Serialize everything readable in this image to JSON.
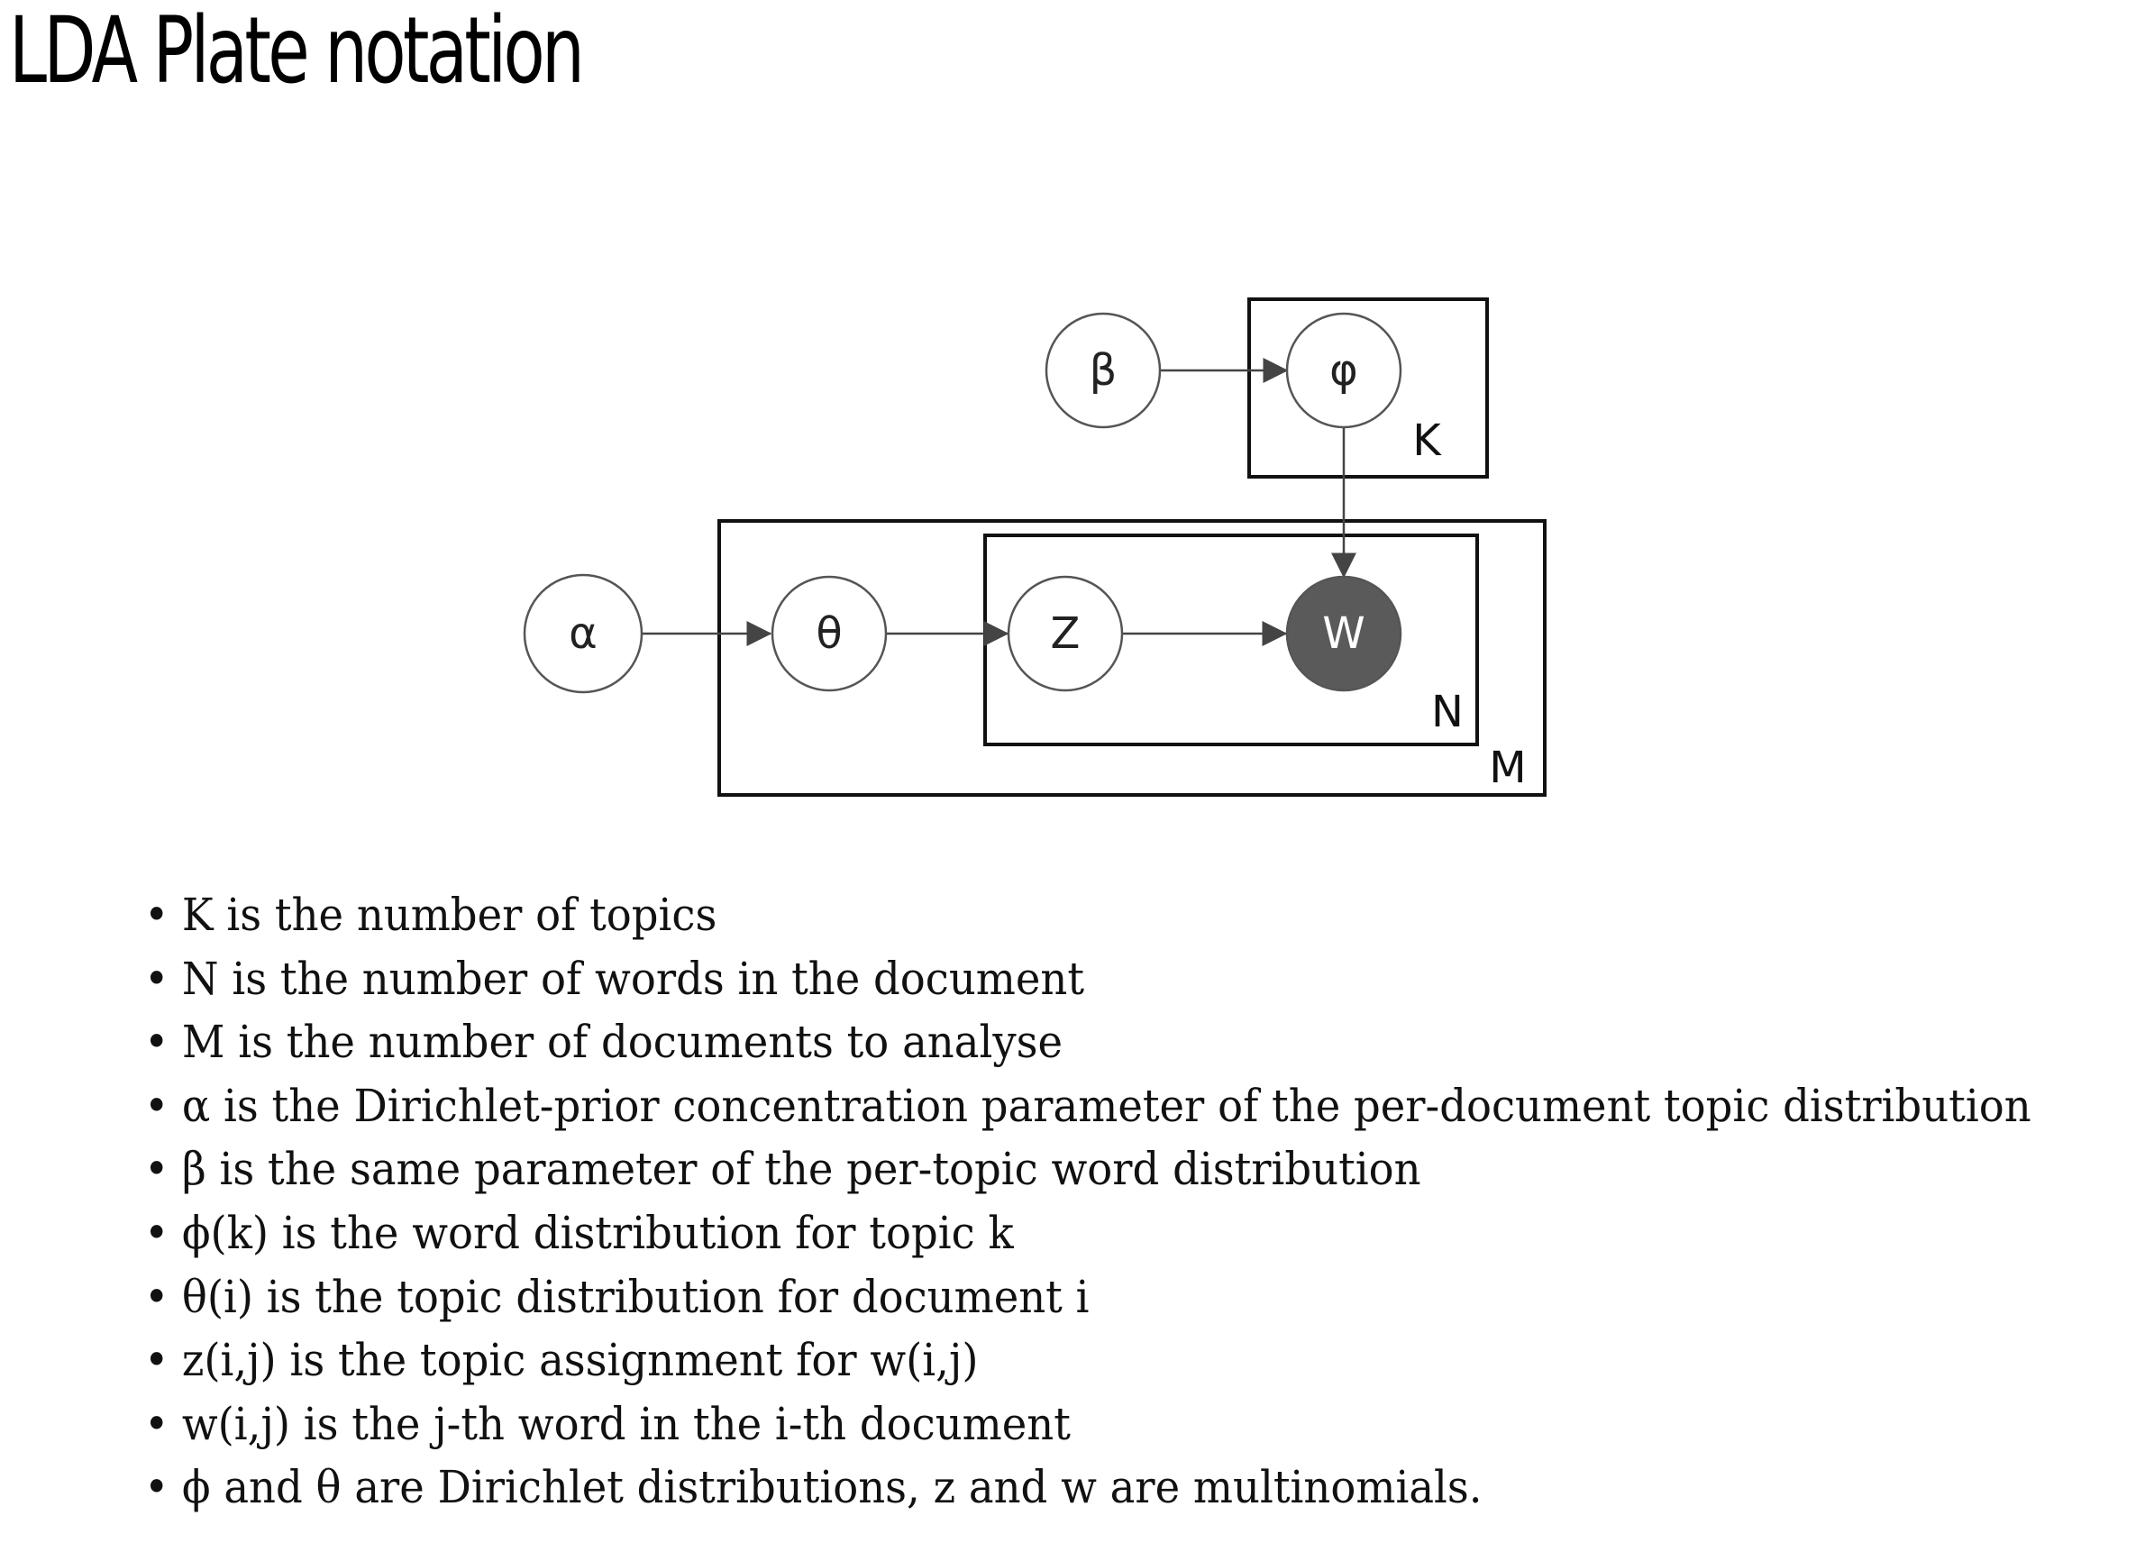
{
  "title": "LDA Plate notation",
  "diagram": {
    "nodes": {
      "alpha": {
        "label": "α",
        "observed": false
      },
      "theta": {
        "label": "θ",
        "observed": false
      },
      "z": {
        "label": "Z",
        "observed": false
      },
      "w": {
        "label": "W",
        "observed": true
      },
      "beta": {
        "label": "β",
        "observed": false
      },
      "phi": {
        "label": "φ",
        "observed": false
      }
    },
    "edges": [
      {
        "from": "alpha",
        "to": "theta"
      },
      {
        "from": "theta",
        "to": "z"
      },
      {
        "from": "z",
        "to": "w"
      },
      {
        "from": "beta",
        "to": "phi"
      },
      {
        "from": "phi",
        "to": "w"
      }
    ],
    "plates": {
      "K": {
        "label": "K",
        "contains": [
          "phi"
        ]
      },
      "N": {
        "label": "N",
        "contains": [
          "z",
          "w"
        ]
      },
      "M": {
        "label": "M",
        "contains": [
          "theta",
          "z",
          "w"
        ]
      }
    },
    "colors": {
      "observed_fill": "#5a5a5a",
      "node_fill": "#ffffff",
      "node_stroke": "#555555",
      "edge": "#444444"
    }
  },
  "legend": {
    "bullet": "•",
    "items": [
      "K is the number of topics",
      "N is the number of words in the document",
      "M is the number of documents to analyse",
      "α is the Dirichlet-prior concentration parameter of the per-document topic distribution",
      "β is the same parameter of the per-topic word distribution",
      "ϕ(k) is the word distribution for topic k",
      "θ(i) is the topic distribution for document i",
      "z(i,j) is the topic assignment for w(i,j)",
      "w(i,j) is the j-th word in the i-th document",
      "ϕ and θ are Dirichlet distributions, z and w are multinomials."
    ]
  }
}
